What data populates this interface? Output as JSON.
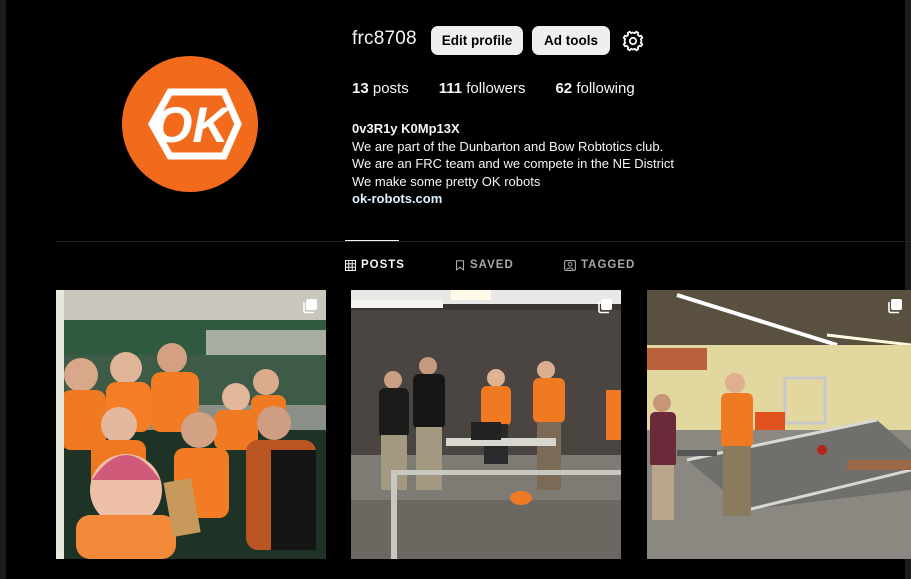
{
  "profile": {
    "username": "frc8708",
    "avatar_text": "OK",
    "brand_color": "#f26b1d",
    "edit_label": "Edit profile",
    "ad_tools_label": "Ad tools",
    "settings_icon": "gear-icon"
  },
  "stats": {
    "posts_count": "13",
    "posts_label": "posts",
    "followers_count": "111",
    "followers_label": "followers",
    "following_count": "62",
    "following_label": "following"
  },
  "bio": {
    "name": "0v3R1y K0Mp13X",
    "line1": "We are part of the Dunbarton and Bow Robtotics club.",
    "line2": "We are an FRC team and we compete in the NE District",
    "line3": "We make some pretty OK robots",
    "link": "ok-robots.com"
  },
  "tabs": [
    {
      "label": "POSTS",
      "icon": "grid-icon",
      "active": true
    },
    {
      "label": "SAVED",
      "icon": "bookmark-icon",
      "active": false
    },
    {
      "label": "TAGGED",
      "icon": "tag-user-icon",
      "active": false
    }
  ],
  "posts": [
    {
      "type": "carousel",
      "scene": "team selfie in orange shirts at arena"
    },
    {
      "type": "carousel",
      "scene": "students and officers at robot field"
    },
    {
      "type": "carousel",
      "scene": "practice field with robot and team members"
    }
  ]
}
